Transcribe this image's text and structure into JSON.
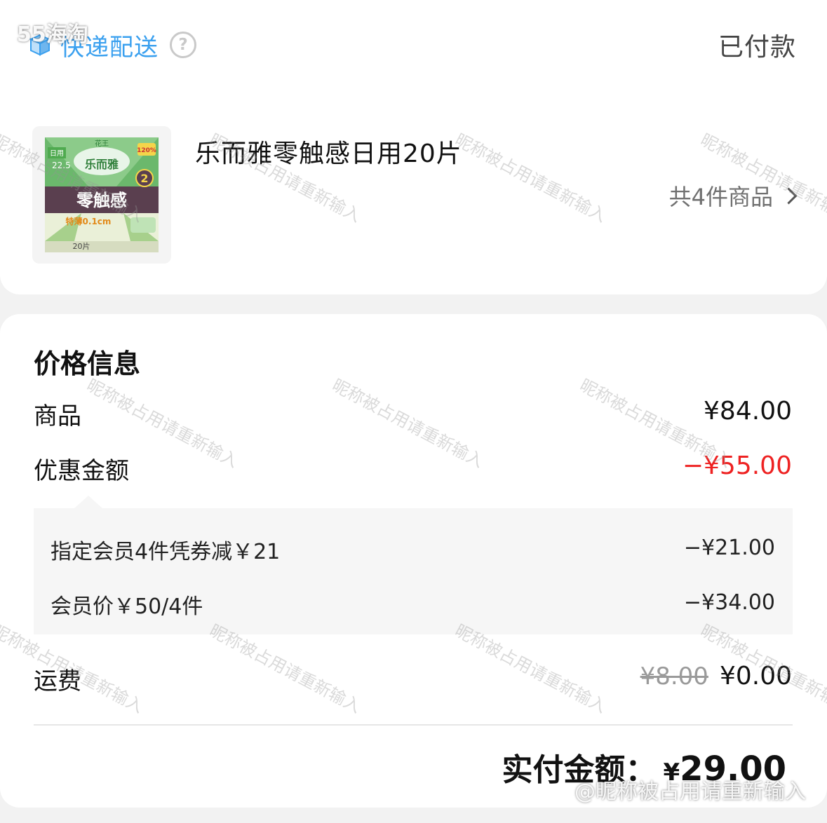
{
  "header": {
    "delivery_label": "快递配送",
    "status": "已付款",
    "help_glyph": "?"
  },
  "product": {
    "name": "乐而雅零触感日用20片",
    "count_link": "共4件商品",
    "package": {
      "brand_top": "花王",
      "brand_mid": "乐而雅",
      "brand_name": "零触感",
      "tag_daily": "日用",
      "size": "22.5",
      "thin": "特薄0.1cm",
      "pieces": "20片",
      "badge": "2",
      "promo": "120%"
    }
  },
  "price_info": {
    "title": "价格信息",
    "goods": {
      "label": "商品",
      "value": "¥84.00"
    },
    "discount": {
      "label": "优惠金额",
      "value": "−¥55.00"
    },
    "discount_details": [
      {
        "label": "指定会员4件凭券减￥21",
        "value": "−¥21.00"
      },
      {
        "label": "会员价￥50/4件",
        "value": "−¥34.00"
      }
    ],
    "shipping": {
      "label": "运费",
      "original": "¥8.00",
      "value": "¥0.00"
    },
    "total": {
      "label": "实付金额：",
      "currency": "¥",
      "amount": "29.00"
    }
  },
  "watermarks": {
    "repeated": "昵称被占用请重新输入",
    "bottom": "@昵称被占用请重新输入",
    "top_left": "55海淘"
  },
  "colors": {
    "accent_blue": "#3aa0ef",
    "discount_red": "#ee2222",
    "page_bg": "#f2f2f2"
  }
}
